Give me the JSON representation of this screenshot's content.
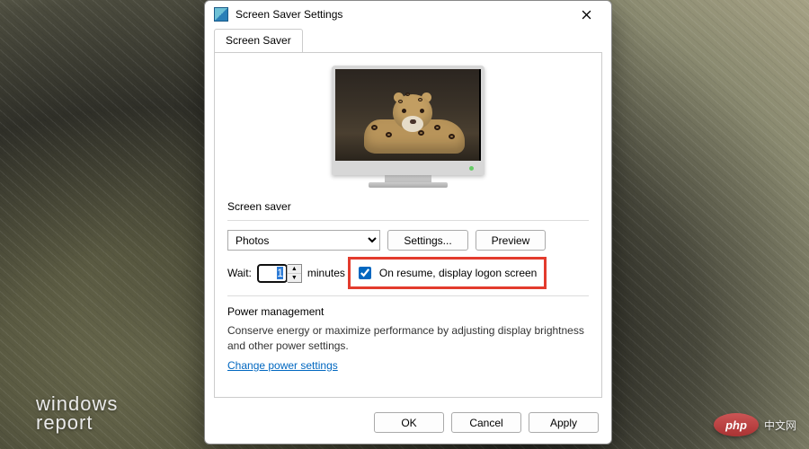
{
  "window": {
    "title": "Screen Saver Settings",
    "tab": "Screen Saver"
  },
  "screensaver": {
    "group_label": "Screen saver",
    "selected": "Photos",
    "settings_button": "Settings...",
    "preview_button": "Preview"
  },
  "wait": {
    "label": "Wait:",
    "value": "1",
    "unit": "minutes",
    "on_resume_label": "On resume, display logon screen",
    "on_resume_checked": true
  },
  "power": {
    "group_label": "Power management",
    "description": "Conserve energy or maximize performance by adjusting display brightness and other power settings.",
    "link": "Change power settings"
  },
  "buttons": {
    "ok": "OK",
    "cancel": "Cancel",
    "apply": "Apply"
  },
  "watermarks": {
    "brand_line1": "windows",
    "brand_line2": "report",
    "php_badge": "php",
    "php_cn": "中文网"
  }
}
